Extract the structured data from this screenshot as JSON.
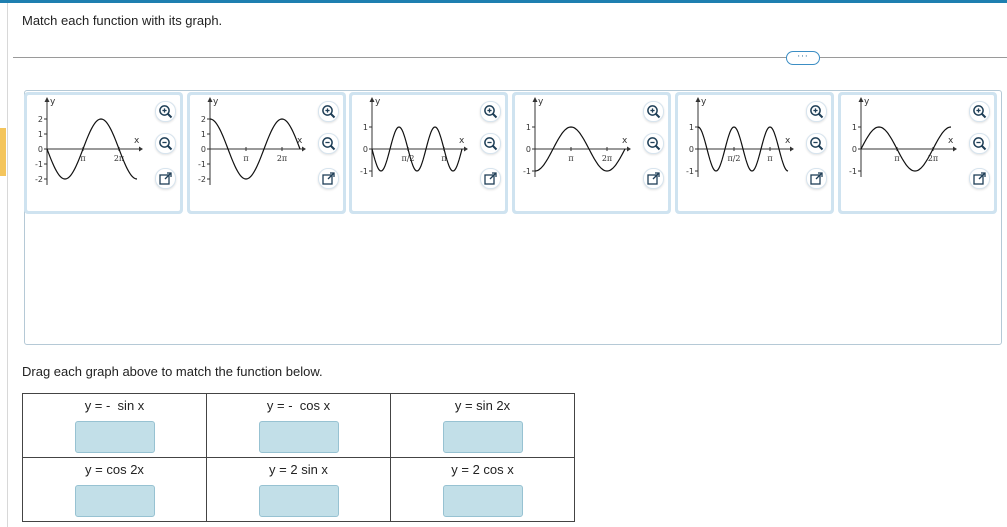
{
  "instruction": "Match each function with its graph.",
  "more_button_label": "···",
  "drag_instruction": "Drag each graph above to match the function below.",
  "colors": {
    "accent": "#1e7fb0",
    "card_border": "#cfe3f0",
    "drop_target": "#c2dfe8"
  },
  "icons": {
    "zoom_in": "zoom-in-icon",
    "zoom_out": "zoom-out-icon",
    "open_new": "open-in-new-window-icon"
  },
  "graphs": [
    {
      "id": "g1",
      "curve": "sin",
      "amp": 2,
      "freq": 1,
      "sign": -1,
      "yticks": [
        "2",
        "1",
        "0",
        "-1",
        "-2"
      ],
      "xtick_a": "π",
      "xtick_b": "2π",
      "axis_y": "y",
      "axis_x": "x"
    },
    {
      "id": "g2",
      "curve": "cos",
      "amp": 2,
      "freq": 1,
      "sign": 1,
      "yticks": [
        "2",
        "1",
        "0",
        "-1",
        "-2"
      ],
      "xtick_a": "π",
      "xtick_b": "2π",
      "axis_y": "y",
      "axis_x": "x"
    },
    {
      "id": "g3",
      "curve": "sin",
      "amp": 1,
      "freq": 2,
      "sign": -1,
      "yticks": [
        "1",
        "0",
        "-1"
      ],
      "xtick_a": "π/2",
      "xtick_b": "π",
      "axis_y": "y",
      "axis_x": "x"
    },
    {
      "id": "g4",
      "curve": "cos",
      "amp": 1,
      "freq": 1,
      "sign": -1,
      "yticks": [
        "1",
        "0",
        "-1"
      ],
      "xtick_a": "π",
      "xtick_b": "2π",
      "axis_y": "y",
      "axis_x": "x"
    },
    {
      "id": "g5",
      "curve": "cos",
      "amp": 1,
      "freq": 2,
      "sign": 1,
      "yticks": [
        "1",
        "0",
        "-1"
      ],
      "xtick_a": "π/2",
      "xtick_b": "π",
      "axis_y": "y",
      "axis_x": "x"
    },
    {
      "id": "g6",
      "curve": "sin",
      "amp": 1,
      "freq": 1,
      "sign": 1,
      "yticks": [
        "1",
        "0",
        "-1"
      ],
      "xtick_a": "π",
      "xtick_b": "2π",
      "axis_y": "y",
      "axis_x": "x"
    }
  ],
  "functions": [
    [
      "y = -  sin x",
      "y = -  cos x",
      "y = sin 2x"
    ],
    [
      "y = cos 2x",
      "y = 2 sin x",
      "y = 2 cos x"
    ]
  ]
}
